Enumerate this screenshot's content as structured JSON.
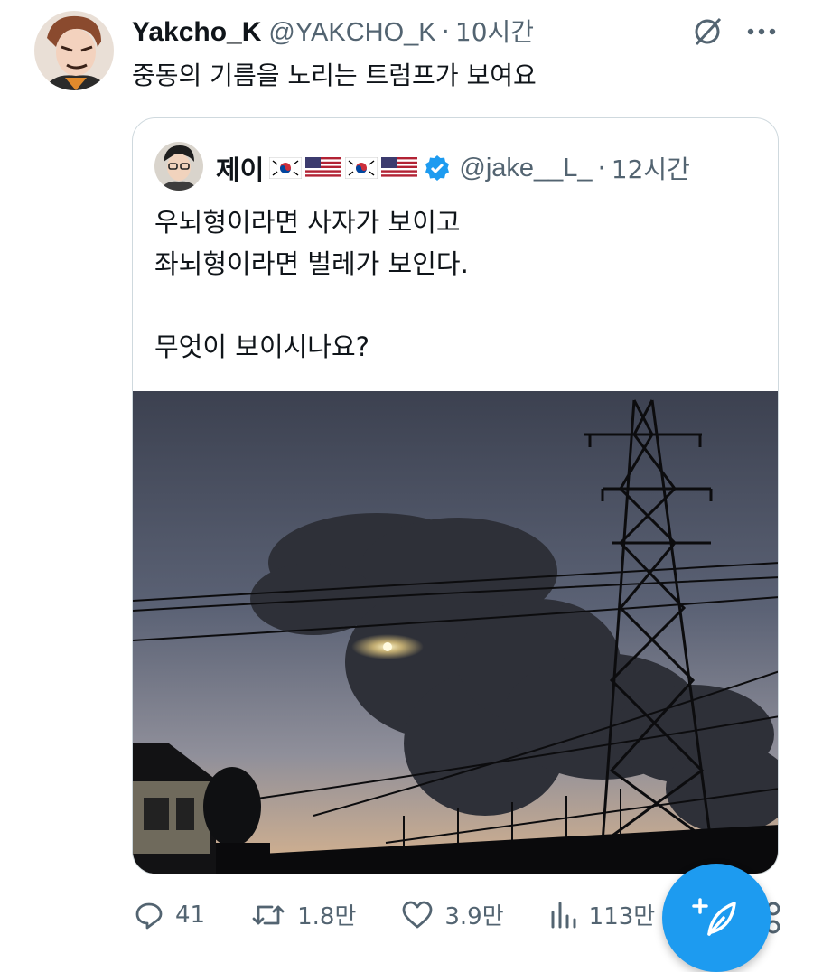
{
  "tweet": {
    "author_name": "Yakcho_K",
    "author_handle": "@YAKCHO_K",
    "separator": "·",
    "time": "10시간",
    "text": "중동의 기름을 노리는 트럼프가 보여요"
  },
  "quoted": {
    "author_name": "제이",
    "author_handle": "@jake__L_",
    "separator": "·",
    "time": "12시간",
    "text": "우뇌형이라면 사자가 보이고\n좌뇌형이라면 벌레가 보인다.\n\n무엇이 보이시나요?"
  },
  "actions": {
    "reply_count": "41",
    "retweet_count": "1.8만",
    "like_count": "3.9만",
    "view_count": "113만"
  },
  "icons": {
    "grok": "slashed-circle-icon",
    "more": "more-icon",
    "verified": "verified-badge-icon",
    "compose": "feather-plus-icon"
  },
  "colors": {
    "accent": "#1d9bf0",
    "secondary_text": "#536471",
    "border": "#cfd9de"
  }
}
